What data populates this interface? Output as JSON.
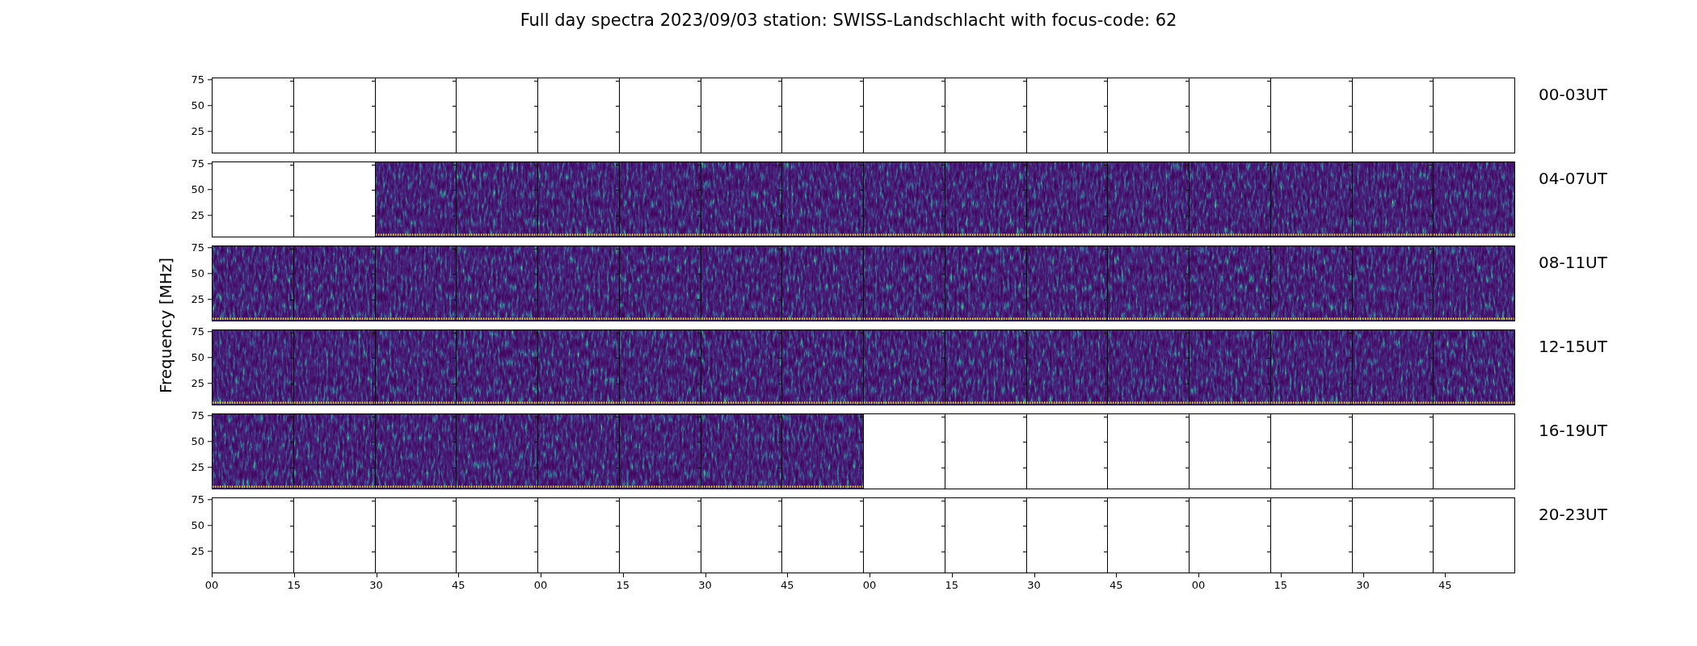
{
  "title": "Full day spectra 2023/09/03 station: SWISS-Landschlacht with focus-code: 62",
  "ylabel": "Frequency [MHz]",
  "xticks": [
    "00",
    "15",
    "30",
    "45",
    "00",
    "15",
    "30",
    "45",
    "00",
    "15",
    "30",
    "45",
    "00",
    "15",
    "30",
    "45"
  ],
  "rows": [
    {
      "label": "00-03UT",
      "yticks": [
        "75",
        "50",
        "25"
      ],
      "panels": [
        false,
        false,
        false,
        false,
        false,
        false,
        false,
        false,
        false,
        false,
        false,
        false,
        false,
        false,
        false,
        false
      ]
    },
    {
      "label": "04-07UT",
      "yticks": [
        "75",
        "50",
        "25"
      ],
      "panels": [
        false,
        false,
        true,
        true,
        true,
        true,
        true,
        true,
        true,
        true,
        true,
        true,
        true,
        true,
        true,
        true
      ]
    },
    {
      "label": "08-11UT",
      "yticks": [
        "75",
        "50",
        "25"
      ],
      "panels": [
        true,
        true,
        true,
        true,
        true,
        true,
        true,
        true,
        true,
        true,
        true,
        true,
        true,
        true,
        true,
        true
      ]
    },
    {
      "label": "12-15UT",
      "yticks": [
        "75",
        "50",
        "25"
      ],
      "panels": [
        true,
        true,
        true,
        true,
        true,
        true,
        true,
        true,
        true,
        true,
        true,
        true,
        true,
        true,
        true,
        true
      ]
    },
    {
      "label": "16-19UT",
      "yticks": [
        "75",
        "50",
        "25"
      ],
      "panels": [
        true,
        true,
        true,
        true,
        true,
        true,
        true,
        true,
        false,
        false,
        false,
        false,
        false,
        false,
        false,
        false
      ]
    },
    {
      "label": "20-23UT",
      "yticks": [
        "75",
        "50",
        "25"
      ],
      "panels": [
        false,
        false,
        false,
        false,
        false,
        false,
        false,
        false,
        false,
        false,
        false,
        false,
        false,
        false,
        false,
        false
      ]
    }
  ]
}
